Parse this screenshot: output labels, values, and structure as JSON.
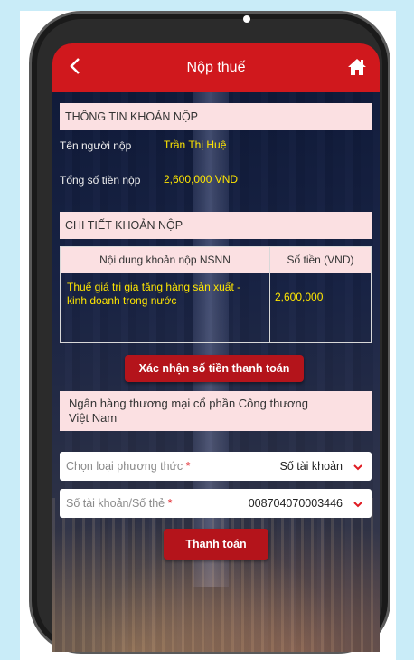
{
  "header": {
    "title": "Nộp thuế",
    "back_icon": "chevron-left-icon",
    "home_icon": "home-icon"
  },
  "payment_info": {
    "heading": "THÔNG TIN KHOẢN NỘP",
    "payer_label": "Tên người nộp",
    "payer_value": "Trần Thị Huệ",
    "total_label": "Tổng số tiền nộp",
    "total_value": "2,600,000 VND"
  },
  "payment_detail": {
    "heading": "CHI TIẾT KHOẢN NỘP",
    "columns": [
      "Nội dung khoản nộp NSNN",
      "Số tiền (VND)"
    ],
    "rows": [
      {
        "content_line1": "Thuế giá trị gia tăng hàng sản xuất -",
        "content_line2": "kinh doanh trong nước",
        "amount": "2,600,000"
      }
    ]
  },
  "confirm_button": "Xác nhận số tiền thanh toán",
  "bank": {
    "line1": "Ngân hàng thương mại cổ phần Công thương",
    "line2": "Việt Nam"
  },
  "method_select": {
    "placeholder": "Chọn loại phương thức",
    "required_mark": "*",
    "value": "Số tài khoản"
  },
  "account_select": {
    "placeholder": "Số tài khoản/Số thẻ",
    "required_mark": "*",
    "value": "008704070003446"
  },
  "pay_button": "Thanh toán",
  "colors": {
    "brand_red": "#d0181d",
    "highlight_yellow": "#ffe600",
    "section_pink": "#fbe0e2"
  }
}
